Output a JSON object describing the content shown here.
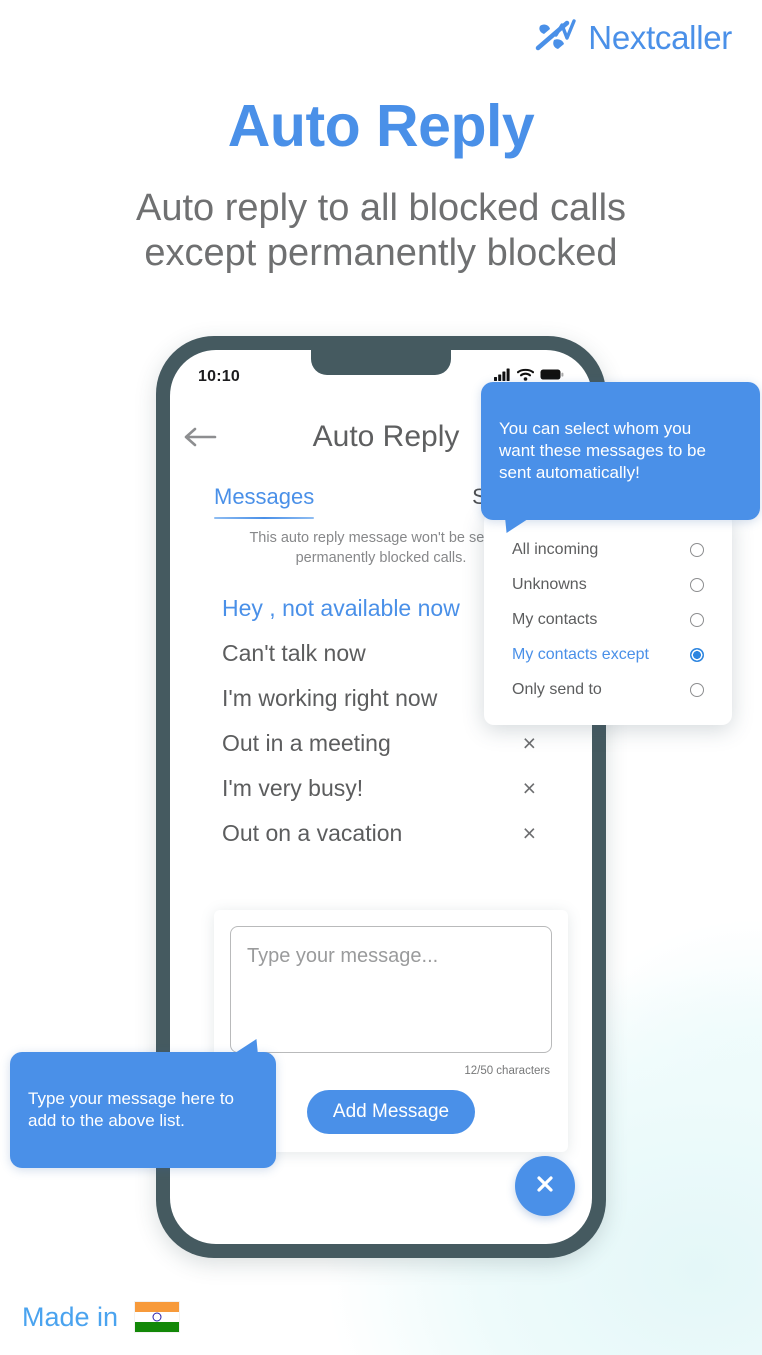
{
  "brand": {
    "name": "Nextcaller",
    "logo_icon": "nextcaller-logo-icon",
    "color": "#4a90e8"
  },
  "header": {
    "title": "Auto Reply",
    "subtitle": "Auto reply to all blocked calls\nexcept permanently blocked",
    "title_color": "#4a90e8",
    "subtitle_color": "#6f7071"
  },
  "phone": {
    "frame_color": "#455a60",
    "status_bar": {
      "time": "10:10",
      "signal_icon": "cellular-signal-icon",
      "wifi_icon": "wifi-icon",
      "battery_icon": "battery-full-icon"
    },
    "app_bar": {
      "back_icon": "back-arrow-icon",
      "title": "Auto Reply"
    },
    "tabs": [
      {
        "label": "Messages",
        "active": true
      },
      {
        "label": "Send to",
        "active": false
      }
    ],
    "notice": "This auto reply message won't be sent to permanently blocked calls.",
    "messages": [
      {
        "text": "Hey , not available now",
        "selected": true,
        "deletable": false
      },
      {
        "text": "Can't talk now",
        "selected": false,
        "deletable": false
      },
      {
        "text": "I'm working right now",
        "selected": false,
        "deletable": false
      },
      {
        "text": "Out in a meeting",
        "selected": false,
        "deletable": true
      },
      {
        "text": "I'm very busy!",
        "selected": false,
        "deletable": true
      },
      {
        "text": "Out on a vacation",
        "selected": false,
        "deletable": true
      }
    ],
    "delete_icon_glyph": "×",
    "compose": {
      "placeholder": "Type your message...",
      "value": "",
      "char_count": "12/50 characters",
      "add_button": "Add Message"
    },
    "fab": {
      "icon": "close-x-icon",
      "glyph": "✕",
      "color": "#4a90e8"
    }
  },
  "dropdown": {
    "options": [
      {
        "label": "All incoming",
        "selected": false
      },
      {
        "label": "Unknowns",
        "selected": false
      },
      {
        "label": "My contacts",
        "selected": false
      },
      {
        "label": "My contacts except",
        "selected": true
      },
      {
        "label": "Only send to",
        "selected": false
      }
    ],
    "selected_color": "#4a90e8"
  },
  "tooltips": {
    "send_to": "You can select whom you\nwant these messages to be\nsent automatically!",
    "compose": "Type your message here to\nadd to the above list.",
    "color": "#4a90e8"
  },
  "footer": {
    "made_in_text": "Made in",
    "flag_icon": "india-flag-icon"
  }
}
